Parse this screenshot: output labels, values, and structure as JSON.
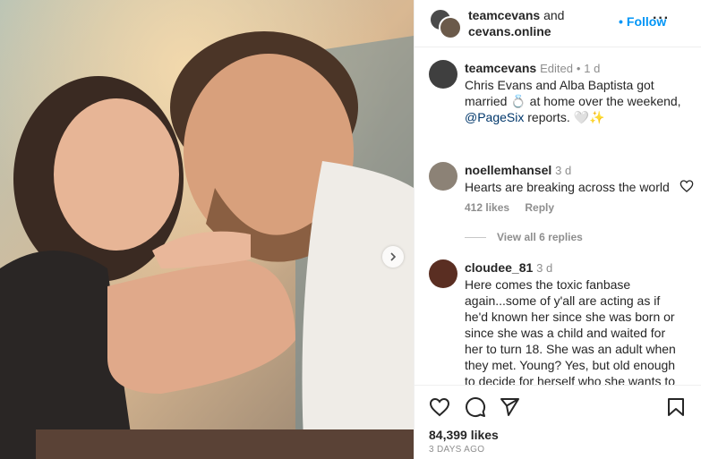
{
  "header": {
    "user1": "teamcevans",
    "conjunction": "and",
    "user2": "cevans.online",
    "follow_label": "Follow",
    "more_label": "···"
  },
  "caption": {
    "username": "teamcevans",
    "edited": "Edited",
    "separator": "•",
    "time": "1 d",
    "text_before_emoji": "Chris Evans and Alba Baptista got married",
    "emoji_ring": "💍",
    "text_mid": " at home over the weekend,",
    "mention": "@PageSix",
    "text_after": " reports. ",
    "emoji_end": "🤍✨"
  },
  "comments": [
    {
      "username": "noellemhansel",
      "time": "3 d",
      "text": "Hearts are breaking across the world",
      "likes": "412 likes",
      "reply_label": "Reply",
      "view_replies": "View all 6 replies"
    },
    {
      "username": "cloudee_81",
      "time": "3 d",
      "text": "Here comes the toxic fanbase again...some of y'all are acting as if he'd known her since she was born or since she was a child and waited for her to turn 18. She was an adult when they met. Young? Yes, but old enough to decide for herself who she wants to"
    }
  ],
  "footer": {
    "likes": "84,399 likes",
    "ago": "3 DAYS AGO"
  },
  "icons": {
    "like": "heart-icon",
    "comment": "comment-icon",
    "share": "send-icon",
    "save": "bookmark-icon",
    "next": "chevron-right-icon"
  },
  "colors": {
    "accent": "#0095f6",
    "text": "#262626",
    "muted": "#8e8e8e",
    "link": "#00376b"
  }
}
